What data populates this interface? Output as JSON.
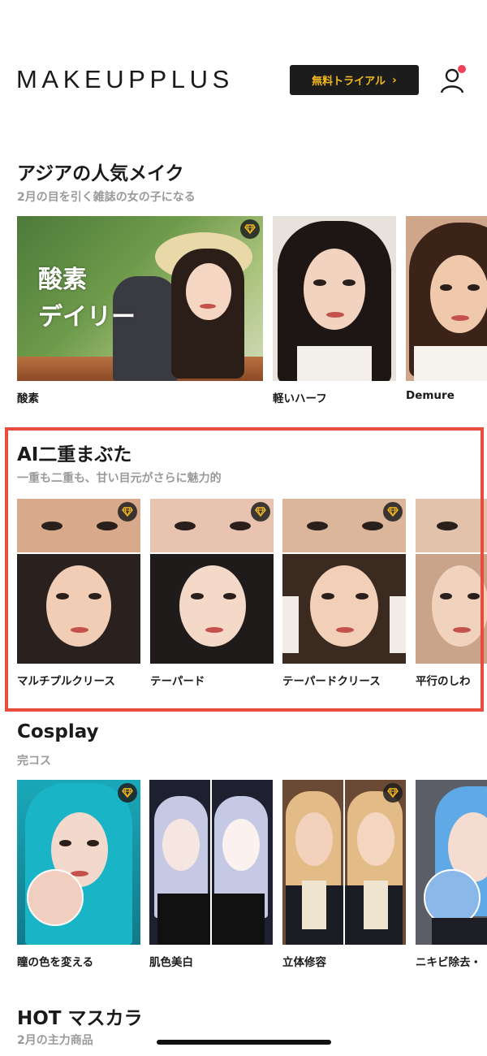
{
  "header": {
    "logo": "MAKEUPPLUS",
    "trial_button": "無料トライアル",
    "trial_chevron": "›"
  },
  "sections": [
    {
      "title": "アジアの人気メイク",
      "subtitle": "2月の目を引く雑誌の女の子になる",
      "cards": [
        {
          "label": "酸素",
          "overlay_text": "酸素\nデイリー",
          "premium": true
        },
        {
          "label": "軽いハーフ",
          "premium": false
        },
        {
          "label": "Demure",
          "premium": false
        }
      ]
    },
    {
      "title": "AI二重まぶた",
      "subtitle": "一重も二重も、甘い目元がさらに魅力的",
      "cards": [
        {
          "label": "マルチプルクリース",
          "premium": true
        },
        {
          "label": "テーパード",
          "premium": true
        },
        {
          "label": "テーパードクリース",
          "premium": true
        },
        {
          "label": "平行のしわ",
          "premium": false
        }
      ]
    },
    {
      "title": "Cosplay",
      "subtitle": "完コス",
      "cards": [
        {
          "label": "瞳の色を変える",
          "premium": true
        },
        {
          "label": "肌色美白",
          "premium": false
        },
        {
          "label": "立体修容",
          "premium": true
        },
        {
          "label": "ニキビ除去・",
          "premium": false
        }
      ]
    },
    {
      "title": "HOT マスカラ",
      "subtitle": "2月の主力商品"
    }
  ],
  "colors": {
    "accent_gold": "#f5b91e",
    "highlight_red": "#e74c3c",
    "notification_dot": "#f0415a"
  },
  "icons": [
    "user-icon",
    "diamond-icon",
    "chevron-right-icon"
  ]
}
